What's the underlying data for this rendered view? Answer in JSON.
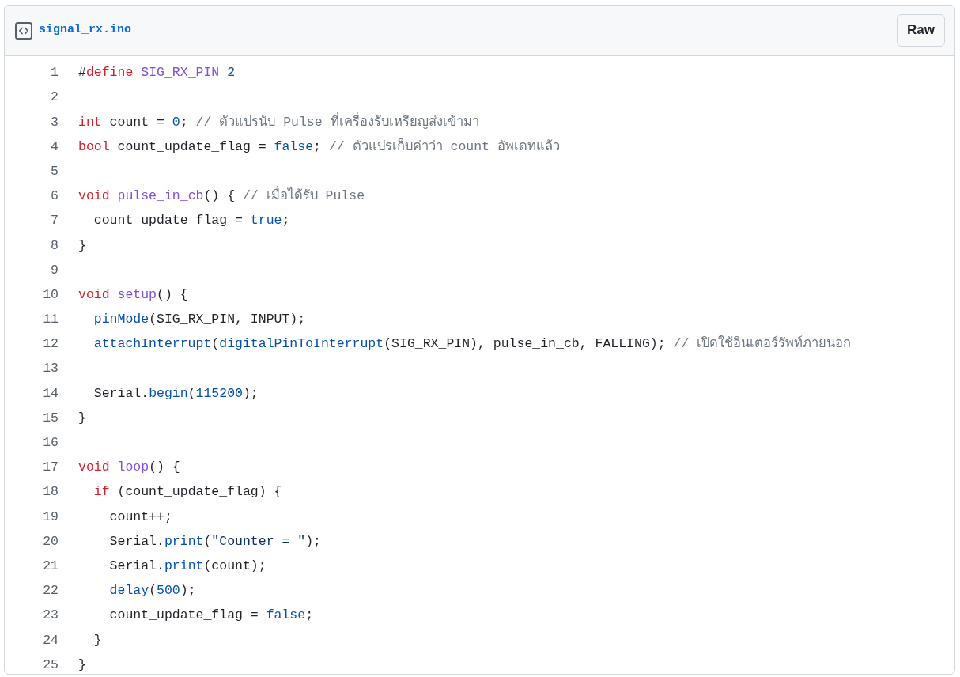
{
  "file": {
    "name": "signal_rx.ino",
    "raw_button": "Raw"
  },
  "lines": [
    {
      "number": "1",
      "tokens": [
        {
          "kind": "plain",
          "text": "#"
        },
        {
          "kind": "keyword",
          "text": "define"
        },
        {
          "kind": "entity",
          "text": " SIG_RX_PIN"
        },
        {
          "kind": "constant",
          "text": " 2"
        }
      ]
    },
    {
      "number": "2"
    },
    {
      "number": "3",
      "tokens": [
        {
          "kind": "keyword",
          "text": "int"
        },
        {
          "kind": "plain",
          "text": " count = "
        },
        {
          "kind": "constant",
          "text": "0"
        },
        {
          "kind": "plain",
          "text": "; "
        },
        {
          "kind": "comment",
          "text": "// ตัวแปรนับ Pulse ที่เครื่องรับเหรียญส่งเข้ามา"
        }
      ]
    },
    {
      "number": "4",
      "tokens": [
        {
          "kind": "keyword",
          "text": "bool"
        },
        {
          "kind": "plain",
          "text": " count_update_flag = "
        },
        {
          "kind": "constant",
          "text": "false"
        },
        {
          "kind": "plain",
          "text": "; "
        },
        {
          "kind": "comment",
          "text": "// ตัวแปรเก็บค่าว่า count อัพเดทแล้ว"
        }
      ]
    },
    {
      "number": "5"
    },
    {
      "number": "6",
      "tokens": [
        {
          "kind": "keyword",
          "text": "void"
        },
        {
          "kind": "entity",
          "text": " pulse_in_cb"
        },
        {
          "kind": "plain",
          "text": "() { "
        },
        {
          "kind": "comment",
          "text": "// เมื่อได้รับ Pulse"
        }
      ]
    },
    {
      "number": "7",
      "tokens": [
        {
          "kind": "plain",
          "text": "  count_update_flag = "
        },
        {
          "kind": "constant",
          "text": "true"
        },
        {
          "kind": "plain",
          "text": ";"
        }
      ]
    },
    {
      "number": "8",
      "tokens": [
        {
          "kind": "plain",
          "text": "}"
        }
      ]
    },
    {
      "number": "9"
    },
    {
      "number": "10",
      "tokens": [
        {
          "kind": "keyword",
          "text": "void"
        },
        {
          "kind": "entity",
          "text": " setup"
        },
        {
          "kind": "plain",
          "text": "() {"
        }
      ]
    },
    {
      "number": "11",
      "tokens": [
        {
          "kind": "constant",
          "text": "  pinMode"
        },
        {
          "kind": "plain",
          "text": "(SIG_RX_PIN, INPUT);"
        }
      ]
    },
    {
      "number": "12",
      "tokens": [
        {
          "kind": "constant",
          "text": "  attachInterrupt"
        },
        {
          "kind": "plain",
          "text": "("
        },
        {
          "kind": "constant",
          "text": "digitalPinToInterrupt"
        },
        {
          "kind": "plain",
          "text": "(SIG_RX_PIN), pulse_in_cb, FALLING); "
        },
        {
          "kind": "comment",
          "text": "// เปิดใช้อินเตอร์รัพท์ภายนอก"
        }
      ]
    },
    {
      "number": "13"
    },
    {
      "number": "14",
      "tokens": [
        {
          "kind": "plain",
          "text": "  Serial."
        },
        {
          "kind": "constant",
          "text": "begin"
        },
        {
          "kind": "plain",
          "text": "("
        },
        {
          "kind": "constant",
          "text": "115200"
        },
        {
          "kind": "plain",
          "text": ");"
        }
      ]
    },
    {
      "number": "15",
      "tokens": [
        {
          "kind": "plain",
          "text": "}"
        }
      ]
    },
    {
      "number": "16"
    },
    {
      "number": "17",
      "tokens": [
        {
          "kind": "keyword",
          "text": "void"
        },
        {
          "kind": "entity",
          "text": " loop"
        },
        {
          "kind": "plain",
          "text": "() {"
        }
      ]
    },
    {
      "number": "18",
      "tokens": [
        {
          "kind": "keyword",
          "text": "  if"
        },
        {
          "kind": "plain",
          "text": " (count_update_flag) {"
        }
      ]
    },
    {
      "number": "19",
      "tokens": [
        {
          "kind": "plain",
          "text": "    count++;"
        }
      ]
    },
    {
      "number": "20",
      "tokens": [
        {
          "kind": "plain",
          "text": "    Serial."
        },
        {
          "kind": "constant",
          "text": "print"
        },
        {
          "kind": "plain",
          "text": "("
        },
        {
          "kind": "string",
          "text": "\"Counter = \""
        },
        {
          "kind": "plain",
          "text": ");"
        }
      ]
    },
    {
      "number": "21",
      "tokens": [
        {
          "kind": "plain",
          "text": "    Serial."
        },
        {
          "kind": "constant",
          "text": "print"
        },
        {
          "kind": "plain",
          "text": "(count);"
        }
      ]
    },
    {
      "number": "22",
      "tokens": [
        {
          "kind": "constant",
          "text": "    delay"
        },
        {
          "kind": "plain",
          "text": "("
        },
        {
          "kind": "constant",
          "text": "500"
        },
        {
          "kind": "plain",
          "text": ");"
        }
      ]
    },
    {
      "number": "23",
      "tokens": [
        {
          "kind": "plain",
          "text": "    count_update_flag = "
        },
        {
          "kind": "constant",
          "text": "false"
        },
        {
          "kind": "plain",
          "text": ";"
        }
      ]
    },
    {
      "number": "24",
      "tokens": [
        {
          "kind": "plain",
          "text": "  }"
        }
      ]
    },
    {
      "number": "25",
      "tokens": [
        {
          "kind": "plain",
          "text": "}"
        }
      ]
    }
  ]
}
